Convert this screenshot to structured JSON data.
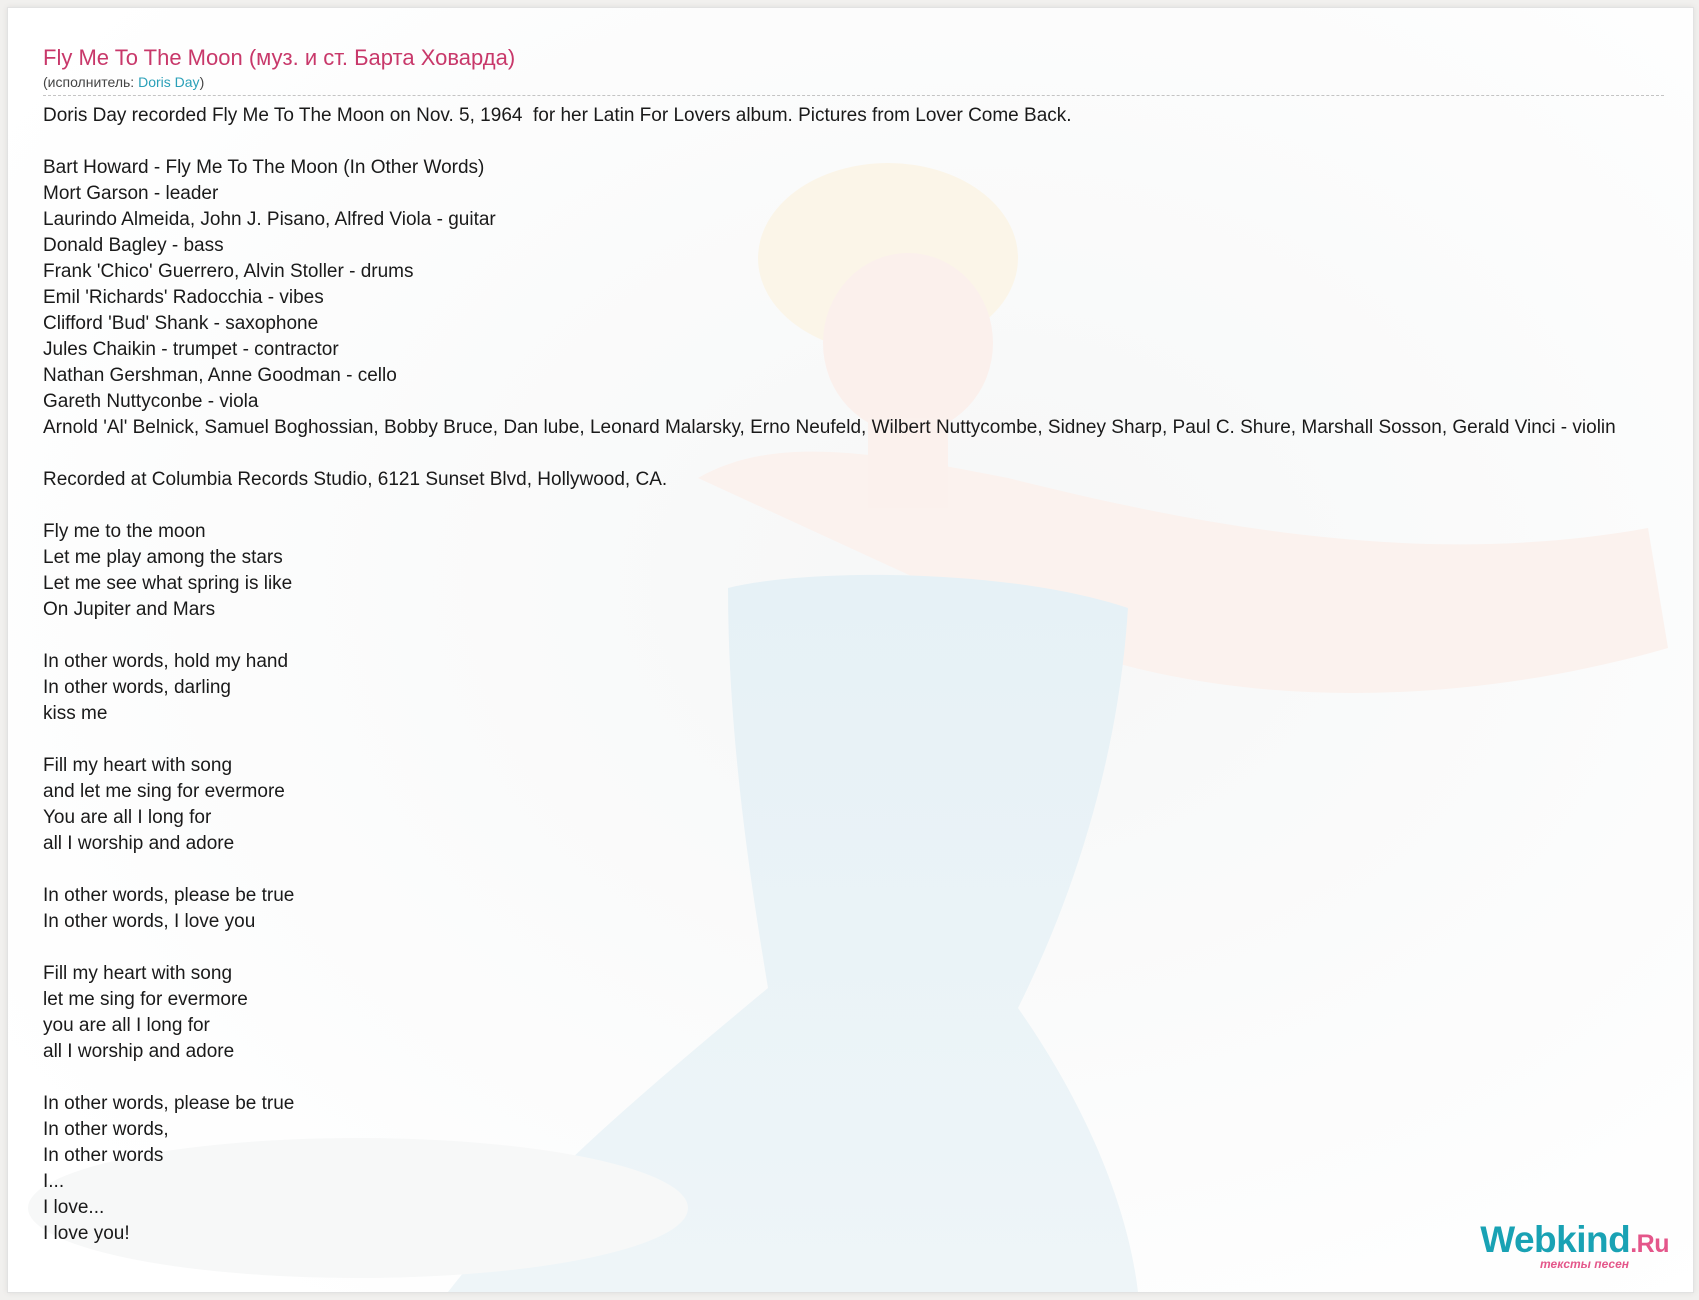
{
  "song": {
    "title": "Fly Me To The Moon (муз. и ст. Барта Ховарда)",
    "performer_prefix": "(исполнитель: ",
    "performer_name": "Doris Day",
    "performer_suffix": ")"
  },
  "lyrics_text": "Doris Day recorded Fly Me To The Moon on Nov. 5, 1964  for her Latin For Lovers album. Pictures from Lover Come Back.\n\nBart Howard - Fly Me To The Moon (In Other Words)\nMort Garson - leader\nLaurindo Almeida, John J. Pisano, Alfred Viola - guitar\nDonald Bagley - bass\nFrank 'Chico' Guerrero, Alvin Stoller - drums\nEmil 'Richards' Radocchia - vibes\nClifford 'Bud' Shank - saxophone\nJules Chaikin - trumpet - contractor\nNathan Gershman, Anne Goodman - cello\nGareth Nuttyconbe - viola\nArnold 'Al' Belnick, Samuel Boghossian, Bobby Bruce, Dan lube, Leonard Malarsky, Erno Neufeld, Wilbert Nuttycombe, Sidney Sharp, Paul C. Shure, Marshall Sosson, Gerald Vinci - violin\n\nRecorded at Columbia Records Studio, 6121 Sunset Blvd, Hollywood, CA.\n\nFly me to the moon\nLet me play among the stars\nLet me see what spring is like\nOn Jupiter and Mars\n\nIn other words, hold my hand\nIn other words, darling\nkiss me\n\nFill my heart with song\nand let me sing for evermore\nYou are all I long for\nall I worship and adore\n\nIn other words, please be true\nIn other words, I love you\n\nFill my heart with song\nlet me sing for evermore\nyou are all I long for\nall I worship and adore\n\nIn other words, please be true\nIn other words,\nIn other words\nI...\nI love...\nI love you!",
  "logo": {
    "main": "Webkind",
    "tld": ".Ru",
    "tagline": "тексты песен"
  },
  "colors": {
    "title": "#c8386a",
    "link": "#2aa0b8",
    "logo_main": "#19a2b4",
    "logo_accent": "#e4568a"
  }
}
